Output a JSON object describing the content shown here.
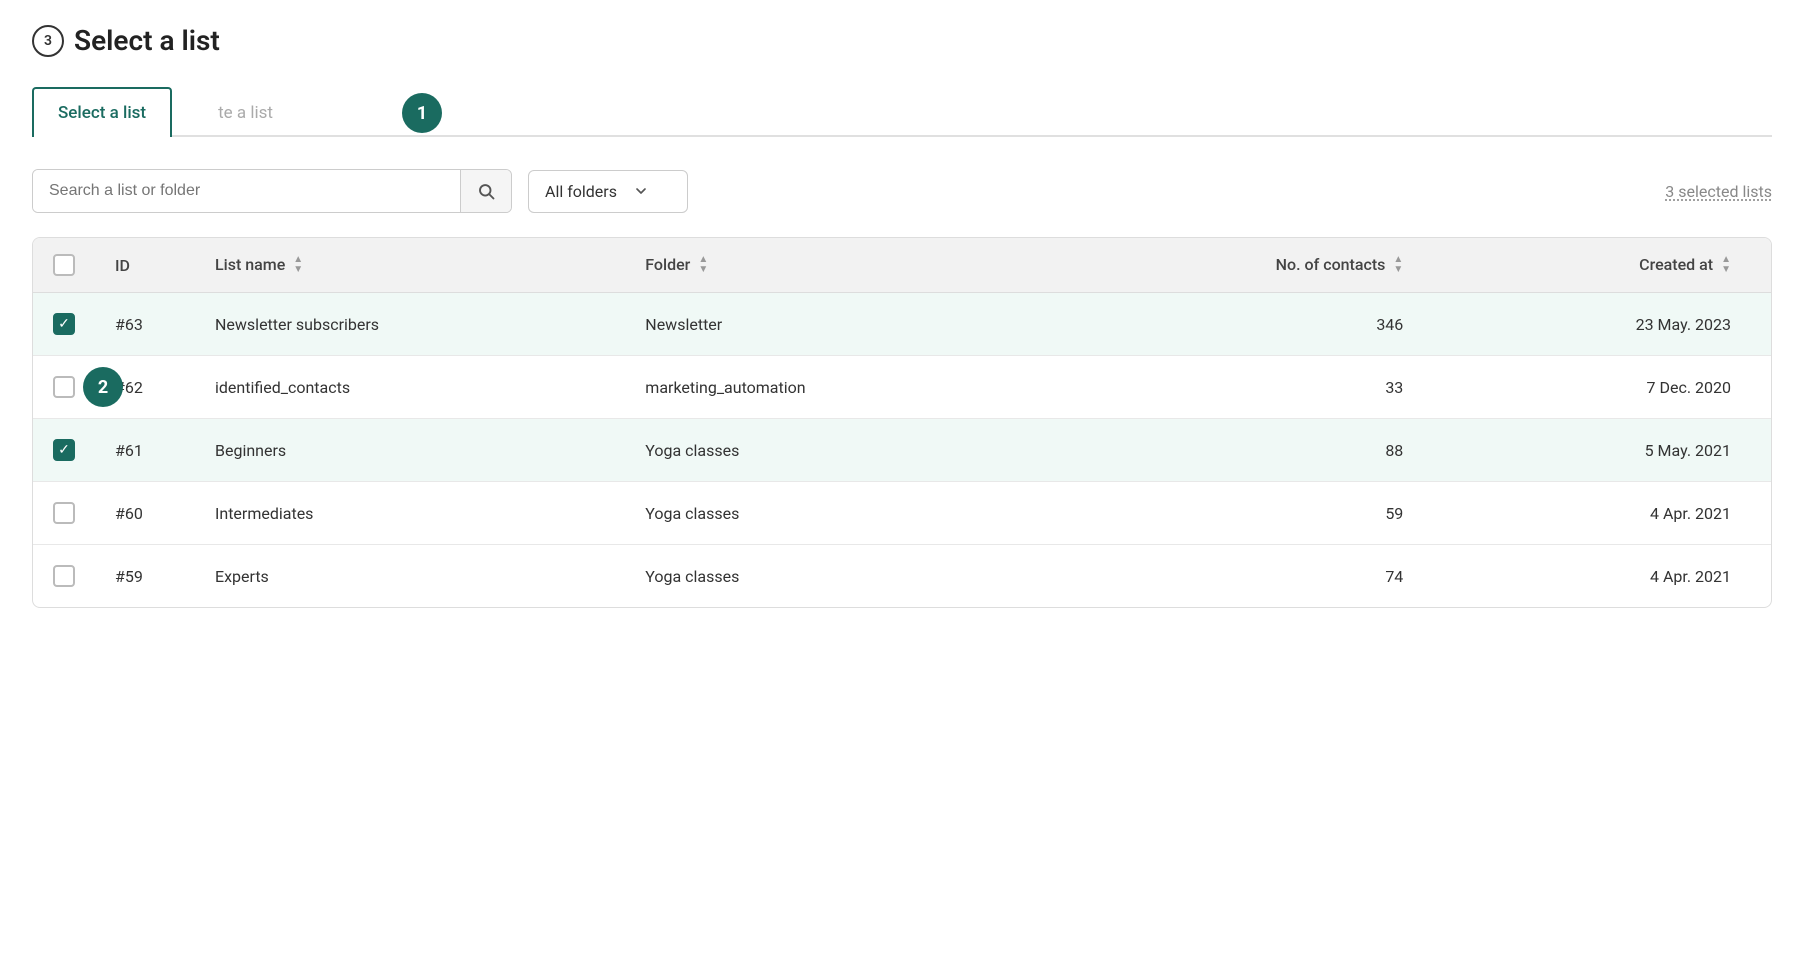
{
  "page": {
    "header": {
      "step_number": "3",
      "title": "Select a list"
    },
    "tabs": [
      {
        "id": "select",
        "label": "Select a list",
        "badge": null,
        "active": true
      },
      {
        "id": "create",
        "label": "te a list",
        "badge": "1",
        "active": false
      }
    ],
    "filter": {
      "search_placeholder": "Search a list or folder",
      "search_icon": "🔍",
      "folder_label": "All folders",
      "selected_count": "3 selected lists"
    },
    "table": {
      "columns": [
        {
          "id": "checkbox",
          "label": ""
        },
        {
          "id": "id",
          "label": "ID"
        },
        {
          "id": "list_name",
          "label": "List name",
          "sortable": true
        },
        {
          "id": "folder",
          "label": "Folder",
          "sortable": true
        },
        {
          "id": "contacts",
          "label": "No. of contacts",
          "sortable": true
        },
        {
          "id": "created_at",
          "label": "Created at",
          "sortable": true
        }
      ],
      "rows": [
        {
          "id": "#63",
          "list_name": "Newsletter subscribers",
          "folder": "Newsletter",
          "contacts": "346",
          "created_at": "23 May. 2023",
          "selected": true
        },
        {
          "id": "#62",
          "list_name": "identified_contacts",
          "folder": "marketing_automation",
          "contacts": "33",
          "created_at": "7 Dec. 2020",
          "selected": false
        },
        {
          "id": "#61",
          "list_name": "Beginners",
          "folder": "Yoga classes",
          "contacts": "88",
          "created_at": "5 May. 2021",
          "selected": true
        },
        {
          "id": "#60",
          "list_name": "Intermediates",
          "folder": "Yoga classes",
          "contacts": "59",
          "created_at": "4 Apr. 2021",
          "selected": false
        },
        {
          "id": "#59",
          "list_name": "Experts",
          "folder": "Yoga classes",
          "contacts": "74",
          "created_at": "4 Apr. 2021",
          "selected": false
        }
      ]
    }
  },
  "annotations": {
    "badge_1": "1",
    "badge_2": "2"
  },
  "colors": {
    "primary": "#1a6b60",
    "selected_row_bg": "#f0f9f6",
    "header_bg": "#f2f2f2"
  }
}
